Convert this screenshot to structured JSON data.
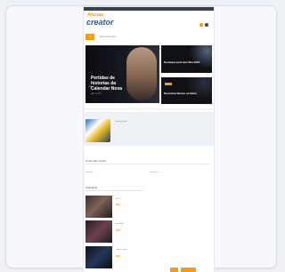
{
  "app": {
    "brand_top": "Ahzuaa",
    "brand_main": "creator"
  },
  "tabs": [
    {
      "label": "Tab"
    },
    {
      "label": "Entertainment"
    }
  ],
  "hero": {
    "kicker": "LIVE",
    "title": "Pertidas de historias da Calendar Nova",
    "meta": "MAY 11 2024"
  },
  "side_cards": [
    {
      "title": "Destaque pelo Seu Ilha 2024"
    },
    {
      "title": "Descubra Shows na Noite"
    }
  ],
  "promo": {
    "title": "Oferta de Natal"
  },
  "section": {
    "title": "Onde abrir social",
    "left_link": "Ver todas",
    "right_link": "Destaques"
  },
  "highlights": {
    "title": "Highlights",
    "items": [
      {
        "title": "Tour 1"
      },
      {
        "title": "Live Music"
      },
      {
        "title": "Concert Series"
      }
    ]
  },
  "bottom": {
    "primary": "",
    "secondary": ""
  }
}
